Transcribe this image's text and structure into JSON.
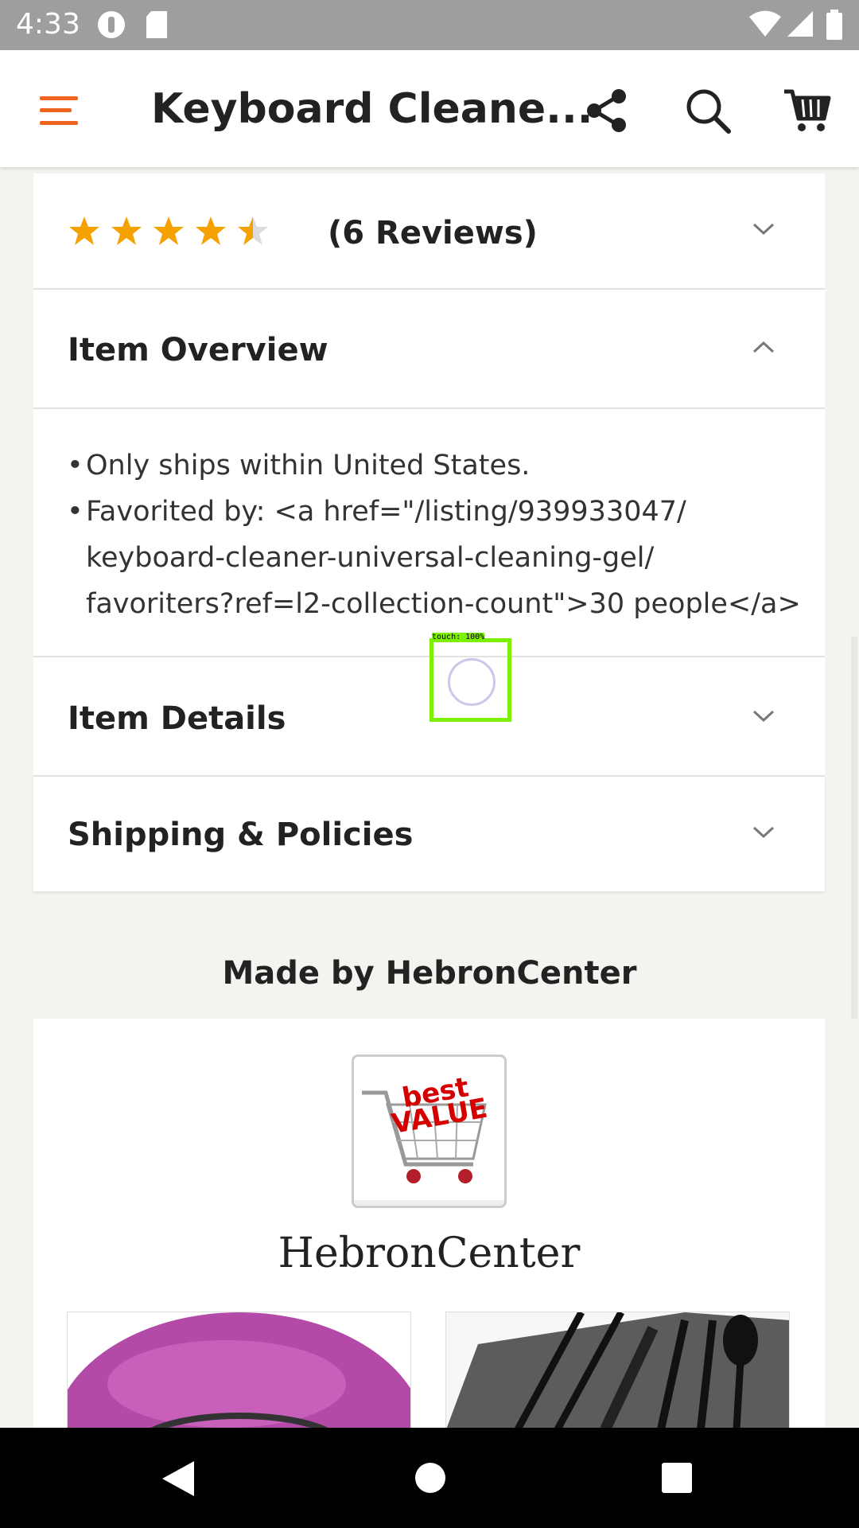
{
  "status_bar": {
    "time": "4:33"
  },
  "app_bar": {
    "title": "Keyboard Cleane..."
  },
  "reviews": {
    "rating": 4.5,
    "count_label": "(6 Reviews)"
  },
  "overview": {
    "title": "Item Overview",
    "bullets": [
      "Only ships within United States.",
      "Favorited by: <a href=\"/listing/939933047/keyboard-cleaner-universal-cleaning-gel/favoriters?ref=l2-collection-count\">30 people</a>"
    ],
    "bullet2_lines": [
      "Favorited by: <a href=\"/listing/939933047/",
      "keyboard-cleaner-universal-cleaning-gel/",
      "favoriters?ref=l2-collection-count\">30 people</a>"
    ]
  },
  "details": {
    "title": "Item Details"
  },
  "shipping": {
    "title": "Shipping & Policies"
  },
  "shop": {
    "heading": "Made by HebronCenter",
    "name": "HebronCenter",
    "logo_text": "best VALUE"
  },
  "touch_overlay": {
    "label": "touch: 100%"
  },
  "colors": {
    "accent": "#f1641e",
    "star": "#f5a100"
  }
}
